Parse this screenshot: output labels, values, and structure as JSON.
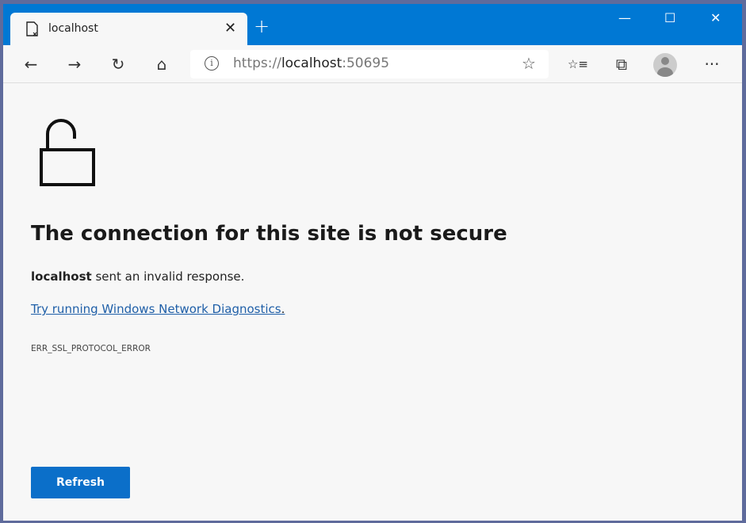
{
  "tab": {
    "title": "localhost",
    "close": "✕",
    "new_tab": "+"
  },
  "window_controls": {
    "minimize": "—",
    "maximize": "☐",
    "close": "✕"
  },
  "toolbar": {
    "back": "←",
    "forward": "→",
    "refresh": "↻",
    "home": "⌂",
    "more": "···",
    "favorite": "☆",
    "favorites": "☆≡",
    "collections": "⧉"
  },
  "address": {
    "scheme": "https://",
    "host": "localhost",
    "port": ":50695"
  },
  "page": {
    "title": "The connection for this site is not secure",
    "host_bold": "localhost",
    "message": " sent an invalid response.",
    "link": "Try running Windows Network Diagnostics",
    "link_suffix": ".",
    "error_code": "ERR_SSL_PROTOCOL_ERROR",
    "refresh_label": "Refresh"
  },
  "colors": {
    "titlebar": "#0078d4",
    "button": "#0b6fc9",
    "link": "#1f5fa8"
  }
}
